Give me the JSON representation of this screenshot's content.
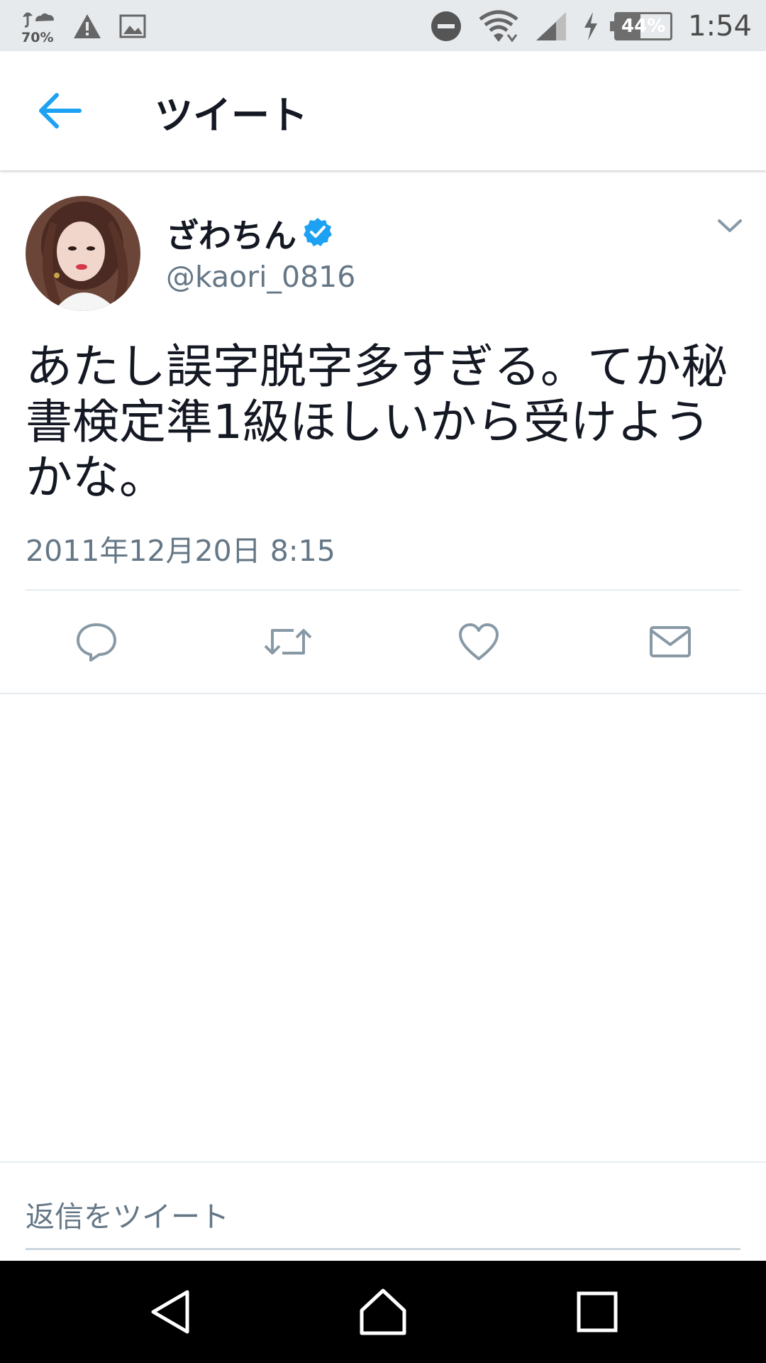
{
  "status_bar": {
    "weather_text": "70%",
    "battery_percent": "44%",
    "battery_level": 0.44,
    "time": "1:54",
    "icons": [
      "umbrella-cloud-icon",
      "warning-icon",
      "image-icon",
      "do-not-disturb-icon",
      "wifi-icon",
      "cell-signal-icon",
      "charging-icon",
      "battery-icon"
    ]
  },
  "header": {
    "back_icon": "back-arrow-icon",
    "title": "ツイート"
  },
  "tweet": {
    "display_name": "ざわちん",
    "verified": true,
    "handle": "@kaori_0816",
    "text": "あたし誤字脱字多すぎる。てか秘書検定準1級ほしいから受けようかな。",
    "timestamp": "2011年12月20日 8:15",
    "actions": [
      "reply-icon",
      "retweet-icon",
      "like-icon",
      "direct-message-icon"
    ]
  },
  "reply": {
    "placeholder": "返信をツイート"
  },
  "nav": {
    "buttons": [
      "back-icon",
      "home-icon",
      "recents-icon"
    ]
  },
  "colors": {
    "accent": "#1da1f2",
    "text_primary": "#141823",
    "text_secondary": "#657786",
    "status_bar_bg": "#e7eaec"
  }
}
